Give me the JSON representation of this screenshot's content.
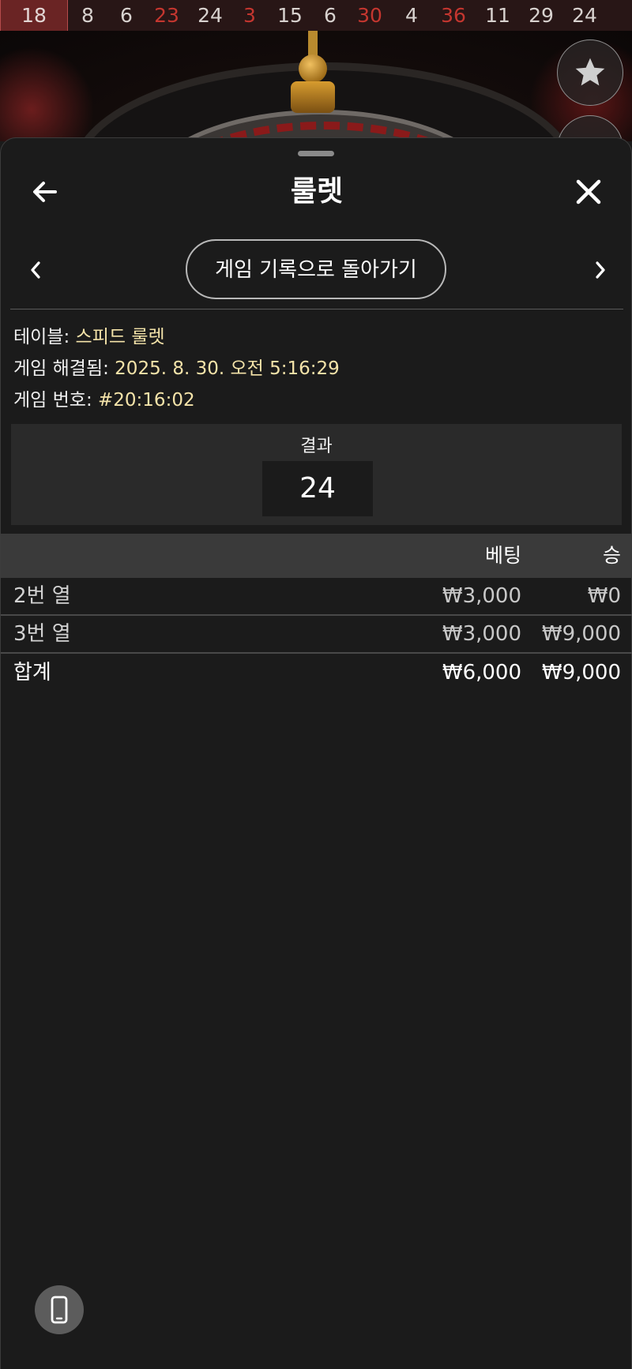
{
  "history": [
    {
      "n": "18",
      "color": "red"
    },
    {
      "n": "8",
      "color": "black"
    },
    {
      "n": "6",
      "color": "black"
    },
    {
      "n": "23",
      "color": "red"
    },
    {
      "n": "24",
      "color": "black"
    },
    {
      "n": "3",
      "color": "red"
    },
    {
      "n": "15",
      "color": "black"
    },
    {
      "n": "6",
      "color": "black"
    },
    {
      "n": "30",
      "color": "red"
    },
    {
      "n": "4",
      "color": "black"
    },
    {
      "n": "36",
      "color": "red"
    },
    {
      "n": "11",
      "color": "black"
    },
    {
      "n": "29",
      "color": "black"
    },
    {
      "n": "24",
      "color": "black"
    }
  ],
  "header": {
    "title": "룰렛",
    "back_icon": "arrow-left-icon",
    "close_icon": "close-icon"
  },
  "nav": {
    "history_button": "게임 기록으로 돌아가기"
  },
  "info": {
    "table_label": "테이블: ",
    "table_value": "스피드 룰렛",
    "resolved_label": "게임 해결됨: ",
    "resolved_value": "2025. 8. 30. 오전 5:16:29",
    "game_no_label": "게임 번호: ",
    "game_no_value": "#20:16:02"
  },
  "result": {
    "label": "결과",
    "value": "24"
  },
  "bets": {
    "headers": {
      "bet": "베팅",
      "win": "승"
    },
    "rows": [
      {
        "name": "2번 열",
        "bet": "₩3,000",
        "win": "₩0"
      },
      {
        "name": "3번 열",
        "bet": "₩3,000",
        "win": "₩9,000"
      }
    ],
    "total": {
      "name": "합계",
      "bet": "₩6,000",
      "win": "₩9,000"
    }
  },
  "colors": {
    "accent_value": "#f4e3a9",
    "red_number": "#c4362f",
    "background": "#1b1b1b"
  }
}
